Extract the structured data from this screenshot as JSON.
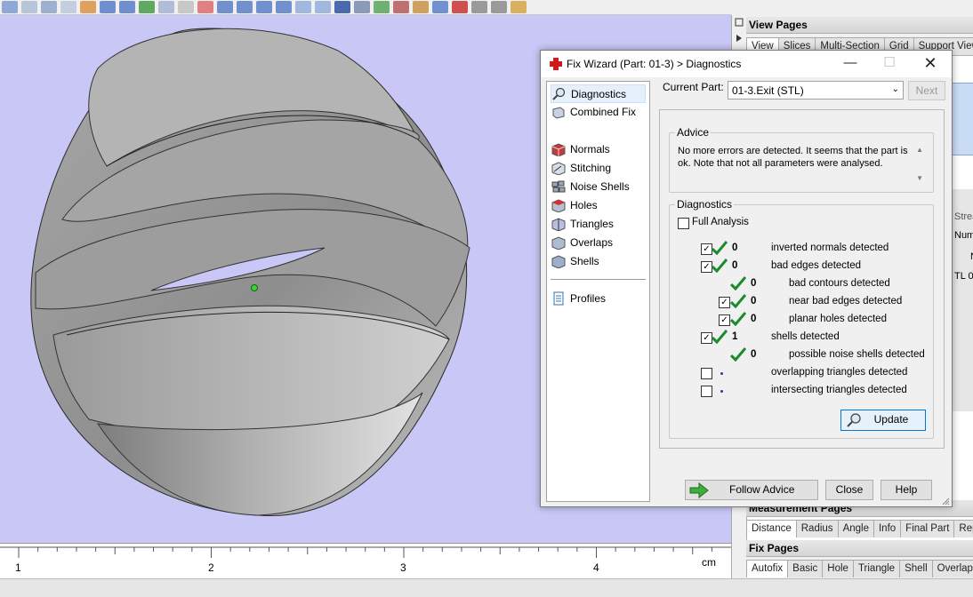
{
  "ruler": {
    "ticks": [
      "1",
      "2",
      "3",
      "4"
    ],
    "unit": "cm"
  },
  "right_panel": {
    "view_pages": {
      "title": "View Pages",
      "tabs": [
        "View",
        "Slices",
        "Multi-Section",
        "Grid",
        "Support View"
      ]
    },
    "side_fragments": {
      "stream": "Strea",
      "num": "Num",
      "n": "N",
      "stl": "TL 0"
    },
    "measurement_pages": {
      "title": "Measurement Pages",
      "tabs": [
        "Distance",
        "Radius",
        "Angle",
        "Info",
        "Final Part",
        "Repo"
      ]
    },
    "fix_pages": {
      "title": "Fix Pages",
      "tabs": [
        "Autofix",
        "Basic",
        "Hole",
        "Triangle",
        "Shell",
        "Overlap"
      ]
    }
  },
  "dialog": {
    "title": "Fix Wizard (Part: 01-3) > Diagnostics",
    "nav": {
      "diagnostics": "Diagnostics",
      "combined_fix": "Combined Fix",
      "normals": "Normals",
      "stitching": "Stitching",
      "noise_shells": "Noise Shells",
      "holes": "Holes",
      "triangles": "Triangles",
      "overlaps": "Overlaps",
      "shells": "Shells",
      "profiles": "Profiles"
    },
    "current_part_label": "Current Part:",
    "current_part_value": "01-3.Exit (STL)",
    "next_label": "Next",
    "advice_title": "Advice",
    "advice_text": "No more errors are detected. It seems that the part is ok. Note that not all parameters were analysed.",
    "diagnostics_title": "Diagnostics",
    "full_analysis_label": "Full Analysis",
    "rows": [
      {
        "checked": true,
        "ok": true,
        "count": "0",
        "label": "inverted normals detected"
      },
      {
        "checked": true,
        "ok": true,
        "count": "0",
        "label": "bad edges detected"
      },
      {
        "checked": null,
        "ok": true,
        "count": "0",
        "label": "bad contours detected"
      },
      {
        "checked": true,
        "ok": true,
        "count": "0",
        "label": "near bad edges detected"
      },
      {
        "checked": true,
        "ok": true,
        "count": "0",
        "label": "planar holes detected"
      },
      {
        "checked": true,
        "ok": true,
        "count": "1",
        "label": "shells detected"
      },
      {
        "checked": null,
        "ok": true,
        "count": "0",
        "label": "possible noise shells detected"
      },
      {
        "checked": false,
        "ok": false,
        "count": "",
        "label": "overlapping triangles detected"
      },
      {
        "checked": false,
        "ok": false,
        "count": "",
        "label": "intersecting triangles detected"
      }
    ],
    "update_label": "Update",
    "follow_advice_label": "Follow Advice",
    "close_label": "Close",
    "help_label": "Help"
  },
  "colors": {
    "viewport_bg": "#c8c7f6",
    "check_green": "#1a8a2a",
    "follow_arrow": "#3fae3f"
  }
}
